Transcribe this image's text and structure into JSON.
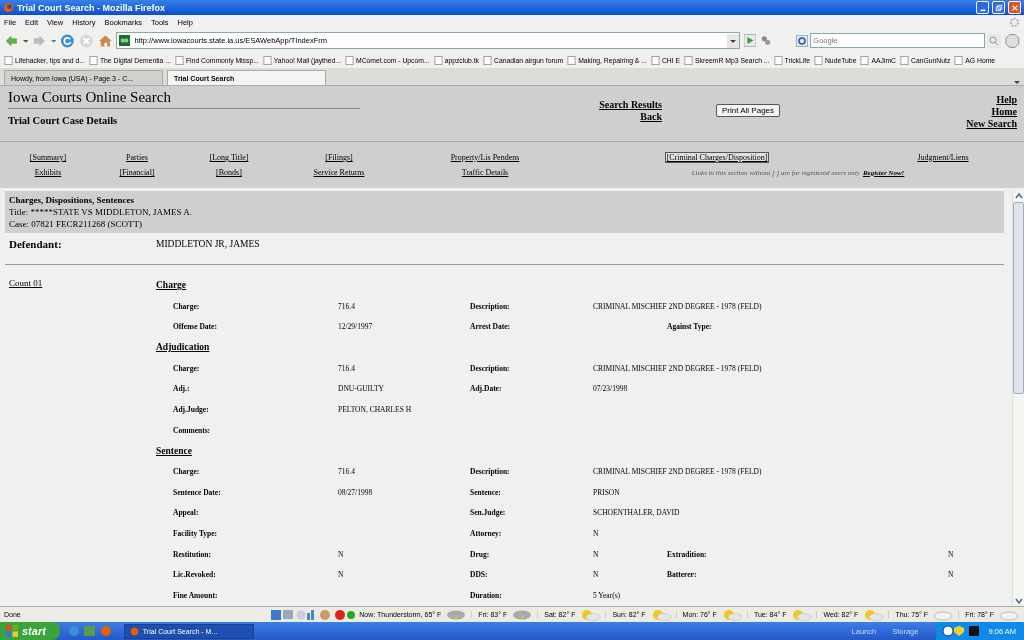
{
  "window": {
    "title": "Trial Court Search - Mozilla Firefox"
  },
  "menu": [
    "File",
    "Edit",
    "View",
    "History",
    "Bookmarks",
    "Tools",
    "Help"
  ],
  "address": {
    "url": "http://www.iowacourts.state.ia.us/ESAWebApp/TIndexFrm"
  },
  "search": {
    "placeholder": "Google"
  },
  "bookmarks": [
    "Lifehacker, tips and d...",
    "The Digital Dementia ...",
    "Find Commonly Missp...",
    "Yahoo! Mail (jaythed...",
    "MComet.com - Upcom...",
    "appzclub.tk",
    "Canadian airgun forum",
    "Making, Repairing & ...",
    "CHI E",
    "SkreemR Mp3 Search ...",
    "TrickLife",
    "NudeTube",
    "AAJimC",
    "CanGunNutz",
    "AG Home"
  ],
  "tabs": [
    {
      "label": "Howdy, from Iowa (USA) - Page 3 - C...",
      "selected": false
    },
    {
      "label": "Trial Court Search",
      "selected": true
    }
  ],
  "header": {
    "title": "Iowa Courts Online Search",
    "subtitle": "Trial Court Case Details",
    "center_links": [
      "Search Results",
      "Back"
    ],
    "print_button": "Print All Pages",
    "right_links": [
      "Help",
      "Home",
      "New Search"
    ]
  },
  "nav": {
    "row_1": [
      {
        "label": "[Summary]",
        "selected": false
      },
      {
        "label": "Parties",
        "selected": false
      },
      {
        "label": "[Long Title]",
        "selected": false
      },
      {
        "label": "[Filings]",
        "selected": false
      },
      {
        "label": "Property/Lis Pendens",
        "selected": false
      },
      {
        "label": "[Criminal Charges/Disposition]",
        "selected": true
      },
      {
        "label": "Judgment/Liens",
        "selected": false
      }
    ],
    "row_2": [
      {
        "label": "Exhibits",
        "selected": false
      },
      {
        "label": "[Financial]",
        "selected": false
      },
      {
        "label": "[Bonds]",
        "selected": false
      },
      {
        "label": "Service Returns",
        "selected": false
      },
      {
        "label": "Traffic Details",
        "selected": false
      }
    ],
    "notice": "Links in this section without [ ] are for registered users only",
    "register_link": "Register Now!"
  },
  "case": {
    "heading": "Charges, Dispositions, Sentences",
    "title": "Title: *****STATE VS MIDDLETON, JAMES A.",
    "case": "Case: 07821 FECR211268 (SCOTT)"
  },
  "defendant": {
    "label": "Defendant:",
    "value": "MIDDLETON JR, JAMES"
  },
  "count": {
    "label": "Count 01",
    "sections": [
      {
        "title": "Charge",
        "rows": [
          [
            {
              "label": "Charge:",
              "value": "716.4"
            },
            {
              "label": "Description:",
              "value": "CRIMINAL MISCHIEF 2ND DEGREE - 1978 (FELD)"
            }
          ],
          [
            {
              "label": "Offense Date:",
              "value": "12/29/1997"
            },
            {
              "label": "Arrest Date:"
            },
            {
              "label": "Against Type:"
            }
          ]
        ]
      },
      {
        "title": "Adjudication",
        "rows": [
          [
            {
              "label": "Charge:",
              "value": "716.4"
            },
            {
              "label": "Description:",
              "value": "CRIMINAL MISCHIEF 2ND DEGREE - 1978 (FELD)"
            }
          ],
          [
            {
              "label": "Adj.:",
              "value": "DNU-GUILTY"
            },
            {
              "label": "Adj.Date:",
              "value": "07/23/1998"
            }
          ],
          [
            {
              "label": "Adj.Judge:",
              "value": "PELTON, CHARLES H"
            }
          ],
          [
            {
              "label": "Comments:"
            }
          ]
        ]
      },
      {
        "title": "Sentence",
        "rows": [
          [
            {
              "label": "Charge:",
              "value": "716.4"
            },
            {
              "label": "Description:",
              "value": "CRIMINAL MISCHIEF 2ND DEGREE - 1978 (FELD)"
            }
          ],
          [
            {
              "label": "Sentence Date:",
              "value": "08/27/1998"
            },
            {
              "label": "Sentence:",
              "value": "PRISON"
            }
          ],
          [
            {
              "label": "Appeal:"
            },
            {
              "label": "Sen.Judge:",
              "value": "SCHOENTHALER, DAVID"
            }
          ],
          [
            {
              "label": "Facility Type:"
            },
            {
              "label": "Attorney:",
              "value": "N"
            }
          ],
          [
            {
              "label": "Restitution:",
              "value": "N"
            },
            {
              "label": "Drug:",
              "value": "N"
            },
            {
              "label": "Extradition:",
              "value": "N"
            }
          ],
          [
            {
              "label": "Lic.Revoked:",
              "value": "N"
            },
            {
              "label": "DDS:",
              "value": "N"
            },
            {
              "label": "Batterer:",
              "value": "N"
            }
          ],
          [
            {
              "label": "Fine Amount:"
            },
            {
              "label": "Duration:",
              "value": "5 Year(s)"
            }
          ]
        ]
      }
    ]
  },
  "status_bar": {
    "text": "Done",
    "weather_now": "Now: Thunderstorm, 65° F",
    "forecast": [
      {
        "day": "Fri: 83° F",
        "kind": "storm"
      },
      {
        "day": "Sat: 82° F",
        "kind": "partly"
      },
      {
        "day": "Sun: 82° F",
        "kind": "partly"
      },
      {
        "day": "Mon: 76° F",
        "kind": "partly"
      },
      {
        "day": "Tue: 84° F",
        "kind": "partly"
      },
      {
        "day": "Wed: 82° F",
        "kind": "partly"
      },
      {
        "day": "Thu: 75° F",
        "kind": "cloudy"
      },
      {
        "day": "Fri: 78° F",
        "kind": "cloudy"
      }
    ]
  },
  "taskbar": {
    "start": "start",
    "task": "Trial Court Search - M...",
    "toolbars": [
      "Launch",
      "Storage"
    ],
    "clock": "9:06 AM"
  }
}
